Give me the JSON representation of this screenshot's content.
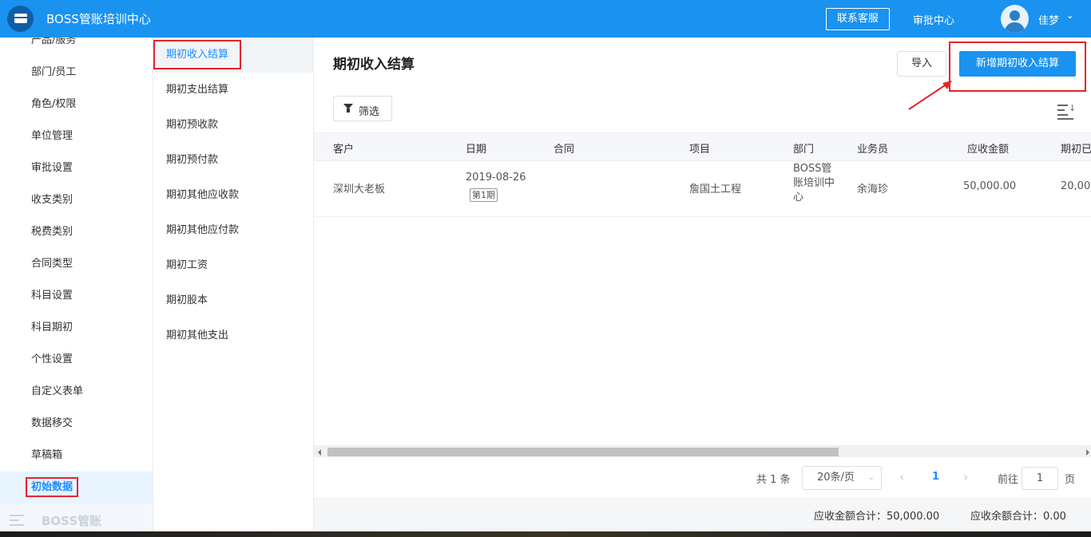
{
  "app": {
    "title": "BOSS管账培训中心",
    "contact_label": "联系客服",
    "approval_label": "审批中心",
    "username": "佳梦"
  },
  "sidebar": {
    "items": [
      {
        "label": "产品/服务"
      },
      {
        "label": "部门/员工"
      },
      {
        "label": "角色/权限"
      },
      {
        "label": "单位管理"
      },
      {
        "label": "审批设置"
      },
      {
        "label": "收支类别"
      },
      {
        "label": "税费类别"
      },
      {
        "label": "合同类型"
      },
      {
        "label": "科目设置"
      },
      {
        "label": "科目期初"
      },
      {
        "label": "个性设置"
      },
      {
        "label": "自定义表单"
      },
      {
        "label": "数据移交"
      },
      {
        "label": "草稿箱"
      },
      {
        "label": "初始数据"
      }
    ],
    "footer_label": "BOSS管账"
  },
  "submenu": {
    "items": [
      {
        "label": "期初收入结算"
      },
      {
        "label": "期初支出结算"
      },
      {
        "label": "期初预收款"
      },
      {
        "label": "期初预付款"
      },
      {
        "label": "期初其他应收款"
      },
      {
        "label": "期初其他应付款"
      },
      {
        "label": "期初工资"
      },
      {
        "label": "期初股本"
      },
      {
        "label": "期初其他支出"
      }
    ]
  },
  "main": {
    "title": "期初收入结算",
    "import_label": "导入",
    "new_label": "新增期初收入结算",
    "filter_label": "筛选",
    "columns": [
      "客户",
      "日期",
      "合同",
      "项目",
      "部门",
      "业务员",
      "应收金额",
      "期初已"
    ],
    "rows": [
      {
        "customer": "深圳大老板",
        "date": "2019-08-26",
        "period": "第1期",
        "contract": "",
        "project": "詹国土工程",
        "department": "BOSS管账培训中心",
        "salesman": "余海珍",
        "receivable": "50,000.00",
        "initial": "20,00"
      }
    ],
    "pagination": {
      "total": "共 1 条",
      "page_size": "20条/页",
      "current_page": "1",
      "goto_label": "前往",
      "goto_value": "1",
      "goto_suffix": "页"
    },
    "summary": {
      "receivable_total": "应收金额合计：50,000.00",
      "balance_total": "应收余额合计：0.00"
    }
  },
  "colors": {
    "primary": "#1a92f0",
    "highlight": "#e8232c",
    "active_text": "#1a8cff"
  }
}
